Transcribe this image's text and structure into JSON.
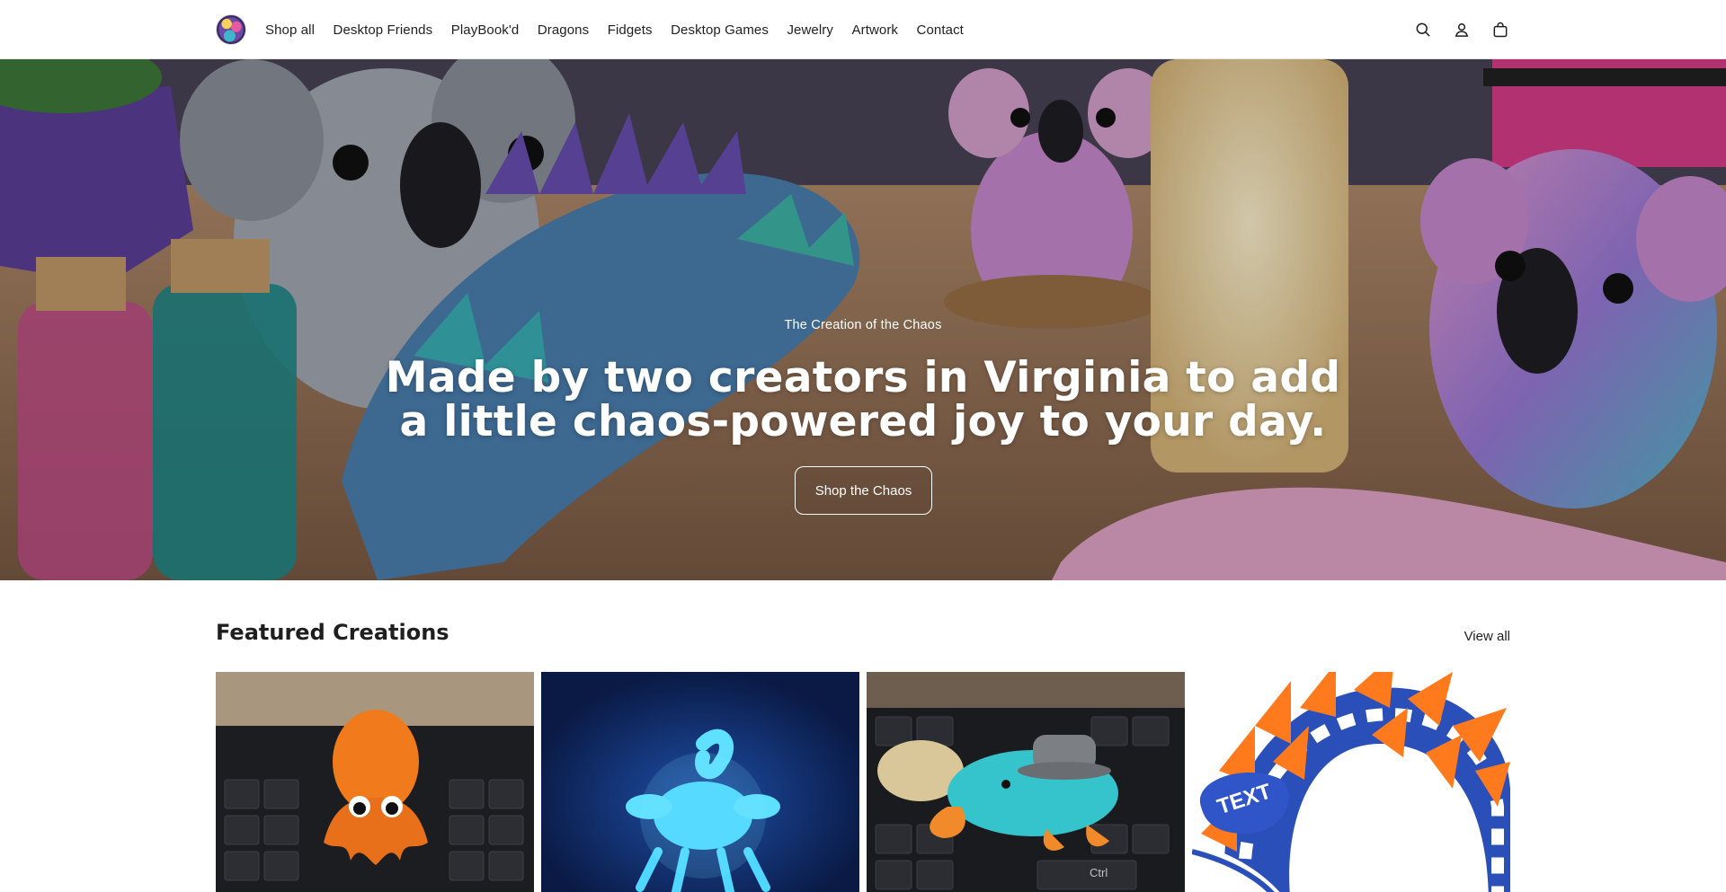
{
  "header": {
    "logo_name": "store-logo",
    "nav": [
      {
        "label": "Shop all"
      },
      {
        "label": "Desktop Friends"
      },
      {
        "label": "PlayBook'd"
      },
      {
        "label": "Dragons"
      },
      {
        "label": "Fidgets"
      },
      {
        "label": "Desktop Games"
      },
      {
        "label": "Jewelry"
      },
      {
        "label": "Artwork"
      },
      {
        "label": "Contact"
      }
    ],
    "icons": [
      "search-icon",
      "account-icon",
      "cart-icon"
    ]
  },
  "hero": {
    "subtitle": "The Creation of the Chaos",
    "title_line1": "Made by two creators in Virginia to add",
    "title_line2": "a little chaos-powered joy to your day.",
    "button_label": "Shop the Chaos"
  },
  "featured": {
    "title": "Featured Creations",
    "view_all_label": "View all",
    "cards": [
      {
        "name": "orange-octopus-product"
      },
      {
        "name": "glowing-scorpion-product"
      },
      {
        "name": "teal-platypus-product",
        "overlay_text": "Ctrl"
      },
      {
        "name": "articulated-dragon-product",
        "overlay_text": "TEXT"
      }
    ]
  },
  "colors": {
    "text": "#1f1f1f",
    "background": "#ffffff",
    "hero_text": "#ffffff"
  }
}
